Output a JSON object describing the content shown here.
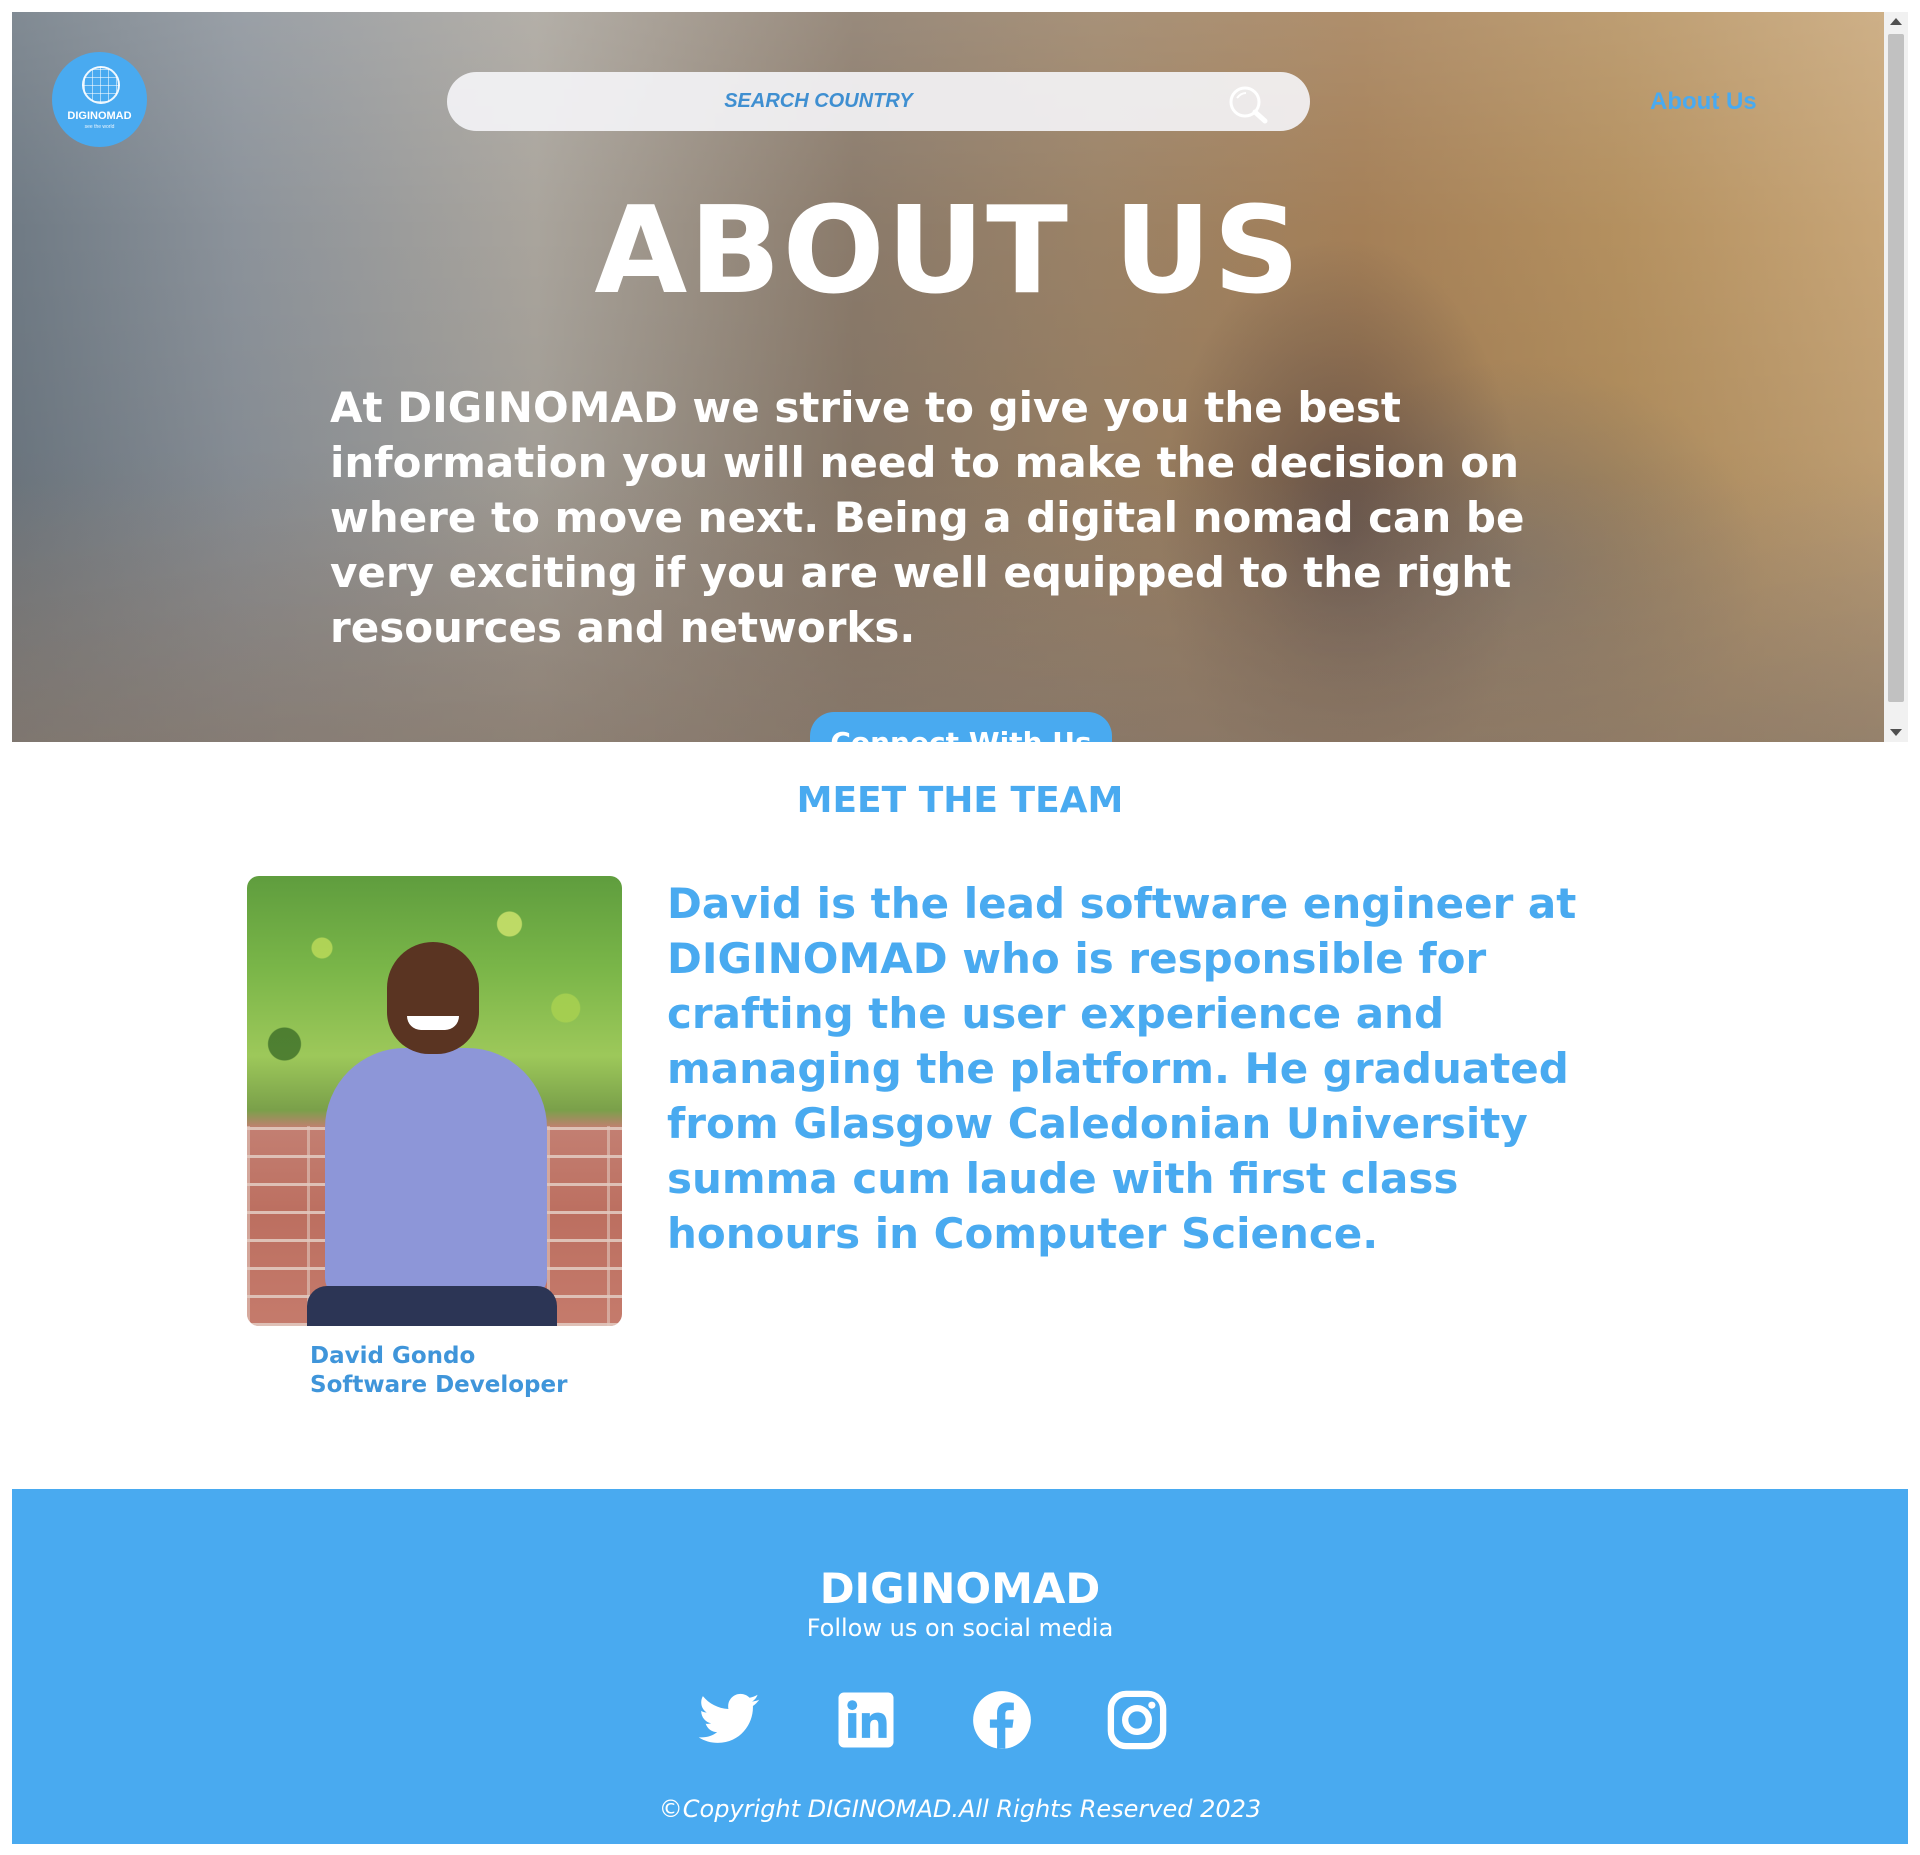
{
  "header": {
    "logo": {
      "text": "DIGINOMAD",
      "tagline": "see the world",
      "icon": "globe-icon"
    },
    "search": {
      "placeholder": "SEARCH COUNTRY",
      "value": "",
      "icon": "search-icon"
    },
    "nav": {
      "about_label": "About Us"
    }
  },
  "hero": {
    "title": "ABOUT US",
    "text": "At DIGINOMAD we strive to give you the best information you will need to make the decision on where to move next. Being a digital nomad can be very exciting if you are well equipped to the right resources and networks.",
    "button_label": "Connect With Us"
  },
  "team": {
    "heading": "MEET THE TEAM",
    "members": [
      {
        "name": "David Gondo",
        "role": "Software Developer",
        "bio": "David is the lead software engineer at DIGINOMAD who is responsible for crafting the user experience and managing the platform. He graduated from Glasgow Caledonian University summa cum laude with first class honours in Computer Science."
      }
    ]
  },
  "footer": {
    "brand": "DIGINOMAD",
    "follow_text": "Follow us on social media",
    "social_icons": [
      "twitter-icon",
      "linkedin-icon",
      "facebook-icon",
      "instagram-icon"
    ],
    "copyright": "©Copyright DIGINOMAD.All Rights Reserved 2023"
  },
  "colors": {
    "accent": "#49aaf0",
    "text_on_accent": "#ffffff"
  }
}
